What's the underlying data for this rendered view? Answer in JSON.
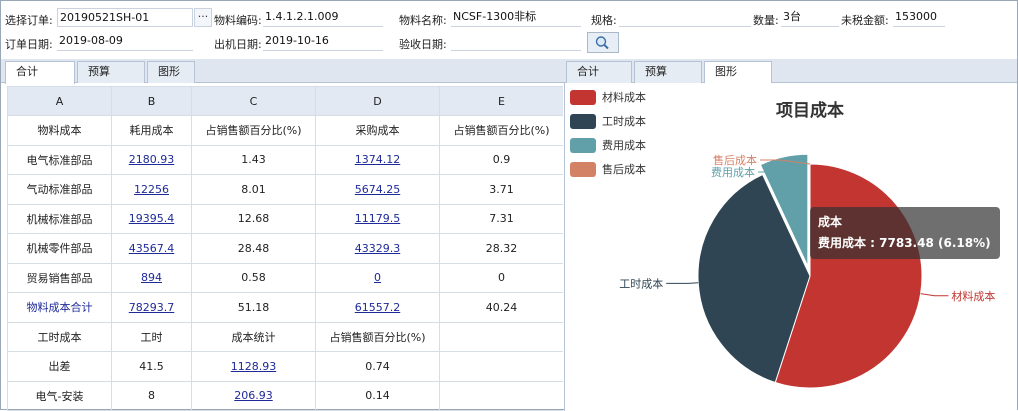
{
  "form": {
    "order_label": "选择订单:",
    "order_value": "20190521SH-01",
    "order_browse": "···",
    "material_code_label": "物料编码:",
    "material_code_value": "1.4.1.2.1.009",
    "material_name_label": "物料名称:",
    "material_name_value": "NCSF-1300非标",
    "spec_label": "规格:",
    "spec_value": "",
    "qty_label": "数量:",
    "qty_value": "3台",
    "amount_label": "未税金额:",
    "amount_value": "153000",
    "order_date_label": "订单日期:",
    "order_date_value": "2019-08-09",
    "ship_date_label": "出机日期:",
    "ship_date_value": "2019-10-16",
    "accept_date_label": "验收日期:",
    "accept_date_value": ""
  },
  "left_tabs": [
    {
      "label": "合计",
      "active": true
    },
    {
      "label": "预算",
      "active": false
    },
    {
      "label": "图形",
      "active": false
    }
  ],
  "right_tabs": [
    {
      "label": "合计",
      "active": false
    },
    {
      "label": "预算",
      "active": false
    },
    {
      "label": "图形",
      "active": true
    }
  ],
  "grid": {
    "columns": [
      "A",
      "B",
      "C",
      "D",
      "E"
    ],
    "rows": [
      {
        "cells": [
          "物料成本",
          "耗用成本",
          "占销售额百分比(%)",
          "采购成本",
          "占销售额百分比(%)"
        ],
        "style": "plain"
      },
      {
        "cells": [
          "电气标准部品",
          "2180.93",
          "1.43",
          "1374.12",
          "0.9"
        ],
        "style": "data"
      },
      {
        "cells": [
          "气动标准部品",
          "12256",
          "8.01",
          "5674.25",
          "3.71"
        ],
        "style": "data"
      },
      {
        "cells": [
          "机械标准部品",
          "19395.4",
          "12.68",
          "11179.5",
          "7.31"
        ],
        "style": "data"
      },
      {
        "cells": [
          "机械零件部品",
          "43567.4",
          "28.48",
          "43329.3",
          "28.32"
        ],
        "style": "data"
      },
      {
        "cells": [
          "贸易销售部品",
          "894",
          "0.58",
          "0",
          "0"
        ],
        "style": "data"
      },
      {
        "cells": [
          "物料成本合计",
          "78293.7",
          "51.18",
          "61557.2",
          "40.24"
        ],
        "style": "total"
      },
      {
        "cells": [
          "工时成本",
          "工时",
          "成本统计",
          "占销售额百分比(%)",
          ""
        ],
        "style": "plain"
      },
      {
        "cells": [
          "出差",
          "41.5",
          "1128.93",
          "0.74",
          ""
        ],
        "style": "labor"
      },
      {
        "cells": [
          "电气-安装",
          "8",
          "206.93",
          "0.14",
          ""
        ],
        "style": "labor"
      }
    ]
  },
  "chart_data": {
    "type": "pie",
    "title": "项目成本",
    "series": [
      {
        "name": "材料成本",
        "value": 61557.2,
        "color": "#c23531"
      },
      {
        "name": "工时成本",
        "value": 42535.32,
        "color": "#2f4554"
      },
      {
        "name": "费用成本",
        "value": 7783.48,
        "color": "#61a0a8"
      },
      {
        "name": "售后成本",
        "value": 0,
        "color": "#d48265"
      }
    ],
    "legend_position": "top-left",
    "tooltip": {
      "title": "成本",
      "text": "费用成本 : 7783.48 (6.18%)"
    }
  }
}
